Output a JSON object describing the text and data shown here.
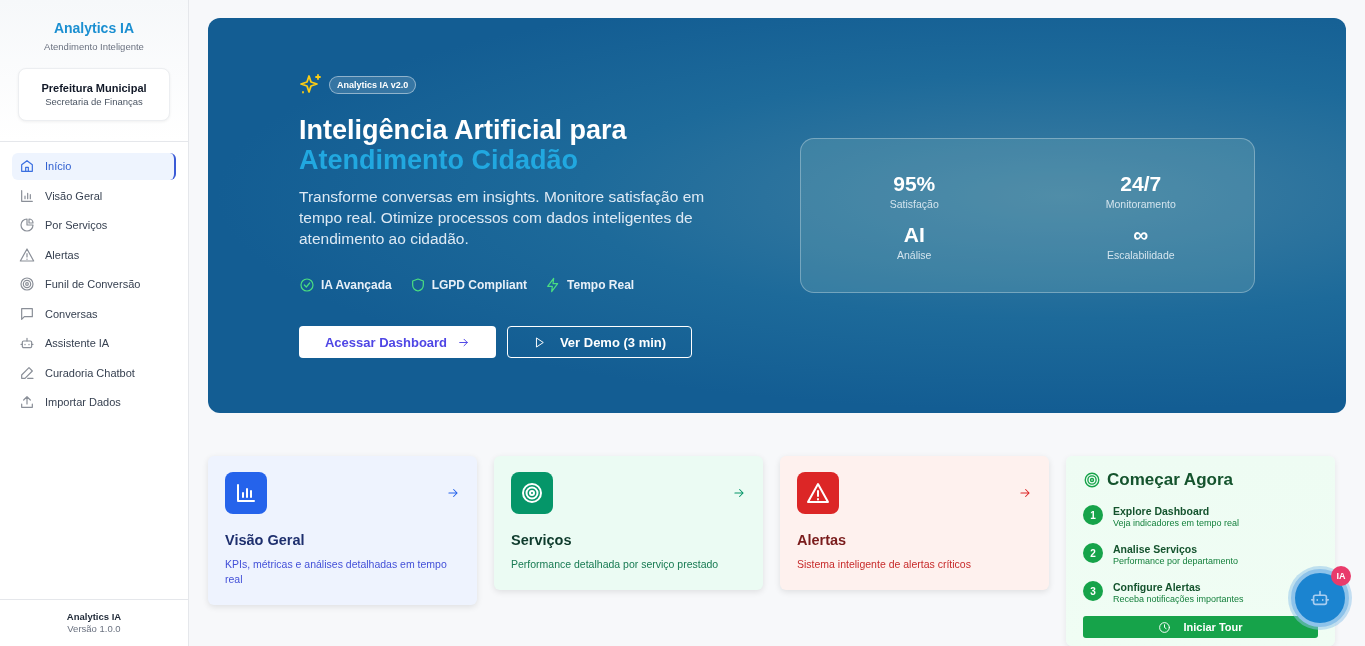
{
  "sidebar": {
    "brand": {
      "title": "Analytics IA",
      "subtitle": "Atendimento Inteligente"
    },
    "org": {
      "name": "Prefeitura Municipal",
      "department": "Secretaria de Finanças"
    },
    "items": [
      {
        "label": "Início",
        "selected": true
      },
      {
        "label": "Visão Geral",
        "selected": false
      },
      {
        "label": "Por Serviços",
        "selected": false
      },
      {
        "label": "Alertas",
        "selected": false
      },
      {
        "label": "Funil de Conversão",
        "selected": false
      },
      {
        "label": "Conversas",
        "selected": false
      },
      {
        "label": "Assistente IA",
        "selected": false
      },
      {
        "label": "Curadoria Chatbot",
        "selected": false
      },
      {
        "label": "Importar Dados",
        "selected": false
      }
    ],
    "footer": {
      "name": "Analytics IA",
      "version": "Versão 1.0.0"
    }
  },
  "hero": {
    "badge": "Analytics IA v2.0",
    "title": "Inteligência Artificial para",
    "title_highlight": "Atendimento Cidadão",
    "description": "Transforme conversas em insights. Monitore satisfação em tempo real. Otimize processos com dados inteligentes de atendimento ao cidadão.",
    "features": [
      "IA Avançada",
      "LGPD Compliant",
      "Tempo Real"
    ],
    "primary_button": "Acessar Dashboard",
    "secondary_button": "Ver Demo (3 min)",
    "stats": [
      {
        "value": "95%",
        "label": "Satisfação"
      },
      {
        "value": "24/7",
        "label": "Monitoramento"
      },
      {
        "value": "AI",
        "label": "Análise"
      },
      {
        "value": "∞",
        "label": "Escalabilidade"
      }
    ]
  },
  "cards": [
    {
      "title": "Visão Geral",
      "description": "KPIs, métricas e análises detalhadas em tempo real",
      "color": "#2563eb"
    },
    {
      "title": "Serviços",
      "description": "Performance detalhada por serviço prestado",
      "color": "#059669"
    },
    {
      "title": "Alertas",
      "description": "Sistema inteligente de alertas críticos",
      "color": "#dc2626"
    }
  ],
  "get_started": {
    "title": "Começar Agora",
    "steps": [
      {
        "number": "1",
        "title": "Explore Dashboard",
        "description": "Veja indicadores em tempo real"
      },
      {
        "number": "2",
        "title": "Analise Serviços",
        "description": "Performance por departamento"
      },
      {
        "number": "3",
        "title": "Configure Alertas",
        "description": "Receba notificações importantes"
      }
    ],
    "button": "Iniciar Tour"
  },
  "chat_fab": {
    "badge": "IA"
  }
}
